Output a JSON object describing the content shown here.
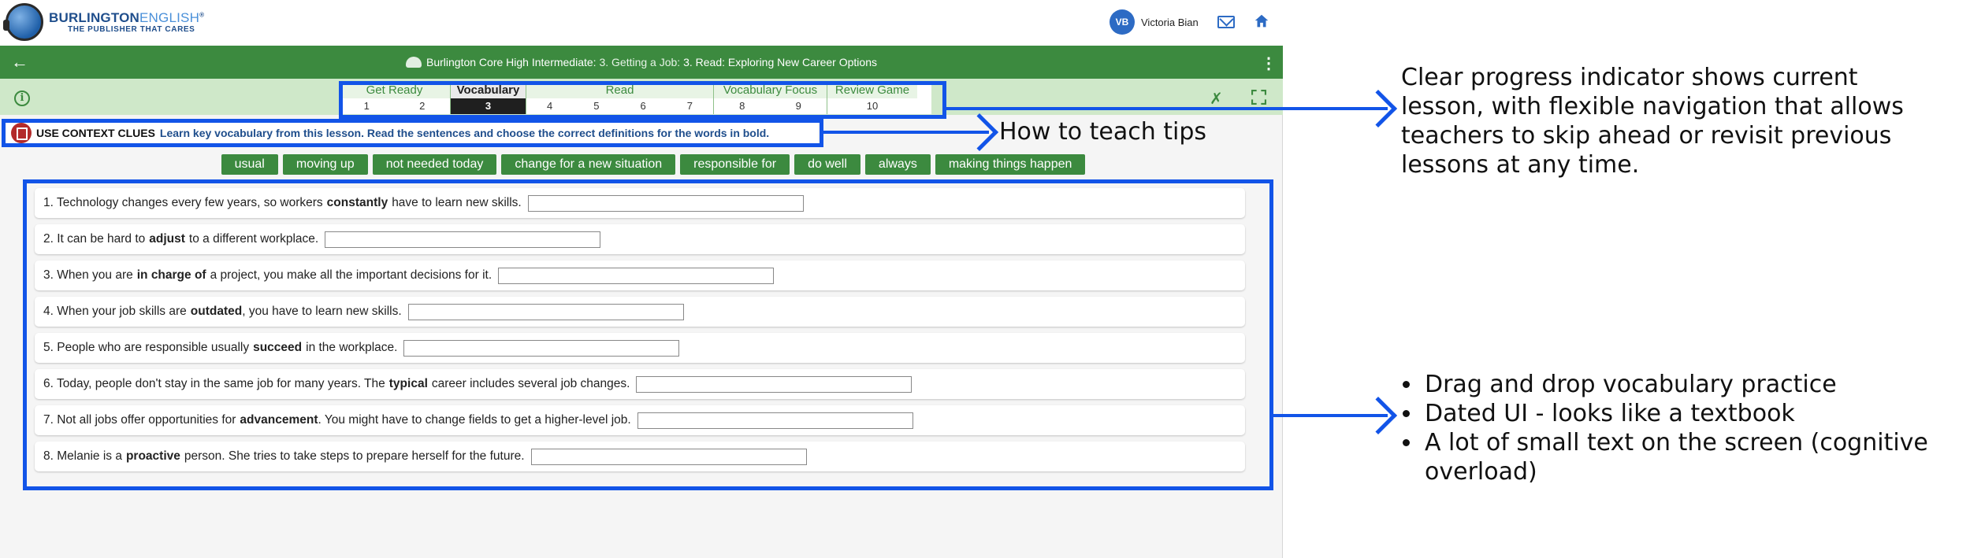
{
  "brand": {
    "name_bold": "BURLINGTON",
    "name_light": "ENGLISH",
    "tagline": "THE PUBLISHER THAT CARES"
  },
  "user": {
    "initials": "VB",
    "name": "Victoria Bian"
  },
  "header": {
    "course": "Burlington Core High Intermediate:",
    "lesson": "3. Getting a Job:",
    "activity": "3. Read: Exploring New Career Options"
  },
  "progress": {
    "groups": [
      {
        "title": "Get Ready",
        "steps": [
          "1",
          "2"
        ]
      },
      {
        "title": "Vocabulary",
        "steps": [
          "3"
        ],
        "active": true
      },
      {
        "title": "Read",
        "steps": [
          "4",
          "5",
          "6",
          "7"
        ]
      },
      {
        "title": "Vocabulary Focus",
        "steps": [
          "8",
          "9"
        ]
      },
      {
        "title": "Review Game",
        "steps": [
          "10"
        ]
      }
    ]
  },
  "instruction": {
    "label": "USE CONTEXT CLUES",
    "text": "Learn key vocabulary from this lesson. Read the sentences and choose the correct definitions for the words in bold."
  },
  "word_bank": [
    "usual",
    "moving up",
    "not needed today",
    "change for a new situation",
    "responsible for",
    "do well",
    "always",
    "making things happen"
  ],
  "sentences": [
    {
      "before": "1. Technology changes every few years, so workers",
      "bold": "constantly",
      "after": "have to learn new skills."
    },
    {
      "before": "2. It can be hard to",
      "bold": "adjust",
      "after": "to a different workplace."
    },
    {
      "before": "3. When you are",
      "bold": "in charge of",
      "after": "a project, you make all the important decisions for it."
    },
    {
      "before": "4. When your job skills are",
      "bold": "outdated",
      "after": ", you have to learn new skills."
    },
    {
      "before": "5. People who are responsible usually",
      "bold": "succeed",
      "after": "in the workplace."
    },
    {
      "before": "6. Today, people don't stay in the same job for many years. The",
      "bold": "typical",
      "after": "career includes several job changes."
    },
    {
      "before": "7. Not all jobs offer opportunities for",
      "bold": "advancement",
      "after": ". You might have to change fields to get a higher-level job."
    },
    {
      "before": "8. Melanie is a",
      "bold": "proactive",
      "after": "person. She tries to take steps to prepare herself for the future."
    }
  ],
  "annotations": {
    "progress_note": "Clear progress indicator shows current lesson, with flexible navigation that allows teachers to skip ahead or revisit previous lessons at any time.",
    "tips_note": "How to teach tips",
    "bullets": [
      "Drag and drop vocabulary practice",
      "Dated UI - looks like a textbook",
      "A lot of small text on the screen (cognitive overload)"
    ],
    "color": "#1254e8"
  },
  "colors": {
    "primary_green": "#3c8a3f",
    "light_green": "#cfe8c9",
    "brand_blue": "#1f4e8c"
  }
}
